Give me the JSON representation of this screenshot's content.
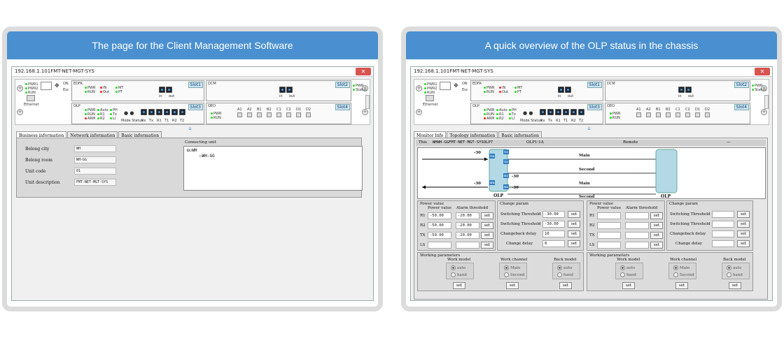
{
  "left_panel": {
    "header": "The page for the Client Management Software",
    "window_title": "192.168.1.101FMT-NET-MGT-SYS",
    "tabs": [
      "Business information",
      "Network information",
      "Basic information"
    ],
    "fields": [
      {
        "label": "Belong city",
        "value": "WH"
      },
      {
        "label": "Belong room",
        "value": "WH-GG"
      },
      {
        "label": "Unit code",
        "value": "01"
      },
      {
        "label": "Unit description",
        "value": "FMT-NET-MGT-SYS"
      }
    ],
    "connecting_unit": {
      "title": "Connecting unit",
      "root": "WH",
      "child": "WH-GG"
    }
  },
  "right_panel": {
    "header": "A quick overview of the OLP status in the chassis",
    "window_title": "192.168.1.101FMT-NET-MGT-SYS",
    "tabs": [
      "Monitor Info",
      "Topology information",
      "Basic information"
    ],
    "status_bar": {
      "this_label": "This",
      "this_value": "WHWH-GGFMT-NET-MGT-SYSOLP7",
      "olp_id": "OLP1:1A",
      "remote": "Remote",
      "dash": "—"
    },
    "diagram": {
      "olp_label": "OLP",
      "ports": [
        "TX",
        "T1",
        "T2",
        "RX",
        "R1",
        "R2"
      ],
      "power_values": [
        "-30",
        "-30",
        "-30",
        "-30"
      ],
      "lines": [
        "Main",
        "Second",
        "Main",
        "Second"
      ]
    },
    "local": {
      "power_title": "Power value",
      "col_power": "Power value",
      "col_alarm": "Alarm threshold",
      "rows": [
        {
          "label": "R1",
          "power": "-50.00",
          "alarm": "-20.00"
        },
        {
          "label": "R2",
          "power": "-50.00",
          "alarm": "-20.00"
        },
        {
          "label": "TX",
          "power": "-50.00",
          "alarm": "-20.00"
        },
        {
          "label": "LS",
          "power": "",
          "alarm": ""
        }
      ],
      "change_title": "Change param",
      "change_rows": [
        {
          "label": "Switching Threshold",
          "value": "-30.00"
        },
        {
          "label": "Switching Threshold",
          "value": "-30.00"
        },
        {
          "label": "Changeback delay",
          "value": "10"
        },
        {
          "label": "Change delay",
          "value": "0"
        }
      ],
      "working_title": "Working parameters",
      "groups": [
        {
          "title": "Work model",
          "options": [
            "auto",
            "hand"
          ]
        },
        {
          "title": "Work channel",
          "options": [
            "Main",
            "Second"
          ]
        },
        {
          "title": "Back model",
          "options": [
            "auto",
            "hand"
          ]
        }
      ]
    },
    "set_label": "set"
  },
  "chassis": {
    "mgmt_leds": [
      "PWR1",
      "PWR2",
      "RUN"
    ],
    "mgmt_marks": [
      "ON",
      "Esc"
    ],
    "ethernet": "Ethernet",
    "slot1": {
      "name": "EDFA",
      "label": "Slot1",
      "leds": [
        "PWR",
        "RUN",
        "IN",
        "Out",
        "MT",
        "PT"
      ],
      "ports": [
        "in",
        "out"
      ]
    },
    "slot2": {
      "name": "DCM",
      "label": "Slot2",
      "ports": [
        "in",
        "out"
      ]
    },
    "slot3": {
      "name": "OLP",
      "label": "Slot3",
      "leds": [
        "PWR",
        "RUN",
        "ARM",
        "Auto",
        "R1",
        "R2",
        "PH",
        "Tx",
        "LI"
      ],
      "mode": "Mode Status",
      "ports": [
        "Rx",
        "Tx",
        "R1",
        "T1",
        "R2",
        "T2"
      ]
    },
    "slot4": {
      "name": "OEO",
      "label": "Slot4",
      "leds": [
        "PWR",
        "RUN"
      ],
      "ports": [
        "A1",
        "A2",
        "B1",
        "B2",
        "C1",
        "C2",
        "D1",
        "D2"
      ]
    },
    "right_leds": [
      "PWR",
      "Status"
    ]
  }
}
